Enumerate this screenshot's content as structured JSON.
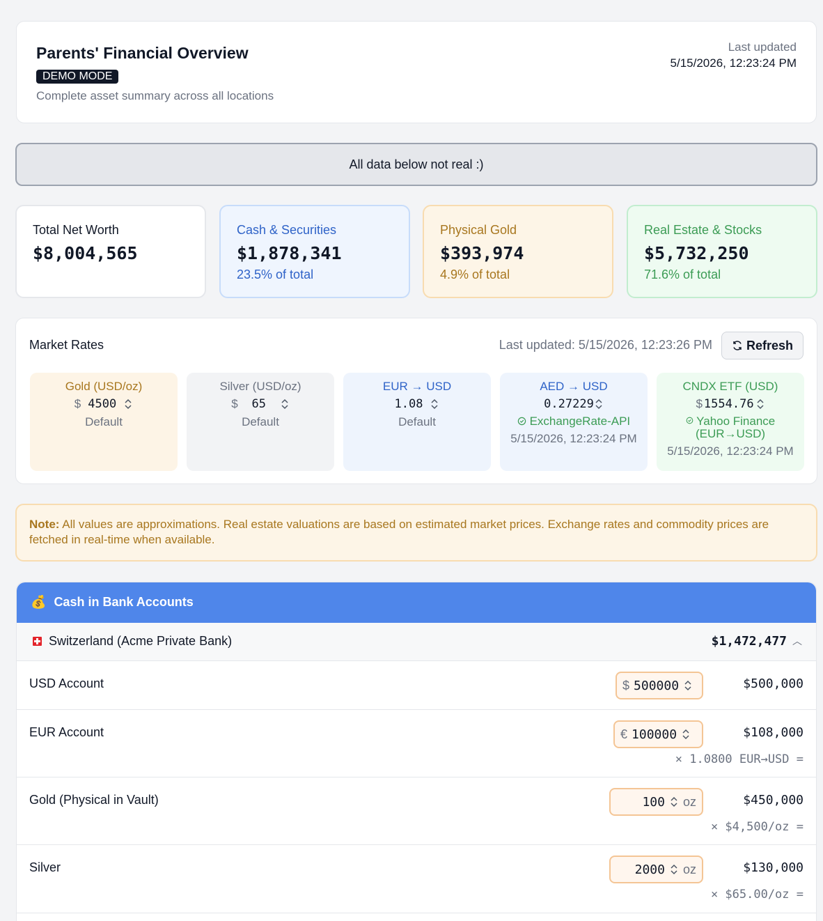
{
  "header": {
    "title": "Parents' Financial Overview",
    "badge": "DEMO MODE",
    "subtitle": "Complete asset summary across all locations",
    "last_updated_label": "Last updated",
    "last_updated_value": "5/15/2026, 12:23:24 PM"
  },
  "banner": "All data below not real :)",
  "summary": {
    "net": {
      "label": "Total Net Worth",
      "value": "$8,004,565"
    },
    "cash": {
      "label": "Cash & Securities",
      "value": "$1,878,341",
      "pct": "23.5% of total"
    },
    "gold": {
      "label": "Physical Gold",
      "value": "$393,974",
      "pct": "4.9% of total"
    },
    "realestate": {
      "label": "Real Estate & Stocks",
      "value": "$5,732,250",
      "pct": "71.6% of total"
    }
  },
  "rates": {
    "title": "Market Rates",
    "last_updated": "Last updated: 5/15/2026, 12:23:26 PM",
    "refresh_label": "Refresh",
    "gold": {
      "label": "Gold (USD/oz)",
      "currency": "$",
      "value": "4500",
      "status": "Default"
    },
    "silver": {
      "label": "Silver (USD/oz)",
      "currency": "$",
      "value": "65",
      "status": "Default"
    },
    "eur": {
      "label": "EUR → USD",
      "value": "1.08",
      "status": "Default"
    },
    "aed": {
      "label": "AED → USD",
      "value": "0.27229",
      "source": "ExchangeRate-API",
      "timestamp": "5/15/2026, 12:23:24 PM"
    },
    "cndx": {
      "label": "CNDX ETF (USD)",
      "currency": "$",
      "value": "1554.76",
      "source": "Yahoo Finance (EUR→USD)",
      "timestamp": "5/15/2026, 12:23:24 PM"
    }
  },
  "note": {
    "bold": "Note:",
    "text": " All values are approximations. Real estate valuations are based on estimated market prices. Exchange rates and commodity prices are fetched in real-time when available."
  },
  "cash_section": {
    "icon": "💰",
    "title": "Cash in Bank Accounts",
    "location": {
      "name": "Switzerland (Acme Private Bank)",
      "total": "$1,472,477"
    },
    "rows": [
      {
        "name": "USD Account",
        "currency": "$",
        "input": "500000",
        "value": "$500,000"
      },
      {
        "name": "EUR Account",
        "currency": "€",
        "input": "100000",
        "value": "$108,000",
        "formula": "× 1.0800 EUR→USD ="
      },
      {
        "name": "Gold (Physical in Vault)",
        "input": "100",
        "unit": "oz",
        "value": "$450,000",
        "formula": "× $4,500/oz ="
      },
      {
        "name": "Silver",
        "input": "2000",
        "unit": "oz",
        "value": "$130,000",
        "formula": "× $65.00/oz ="
      }
    ]
  },
  "colors": {
    "accent": "#4f86ea",
    "gold": "#a8771f",
    "green": "#3c9c55",
    "blue": "#2f63c8"
  }
}
